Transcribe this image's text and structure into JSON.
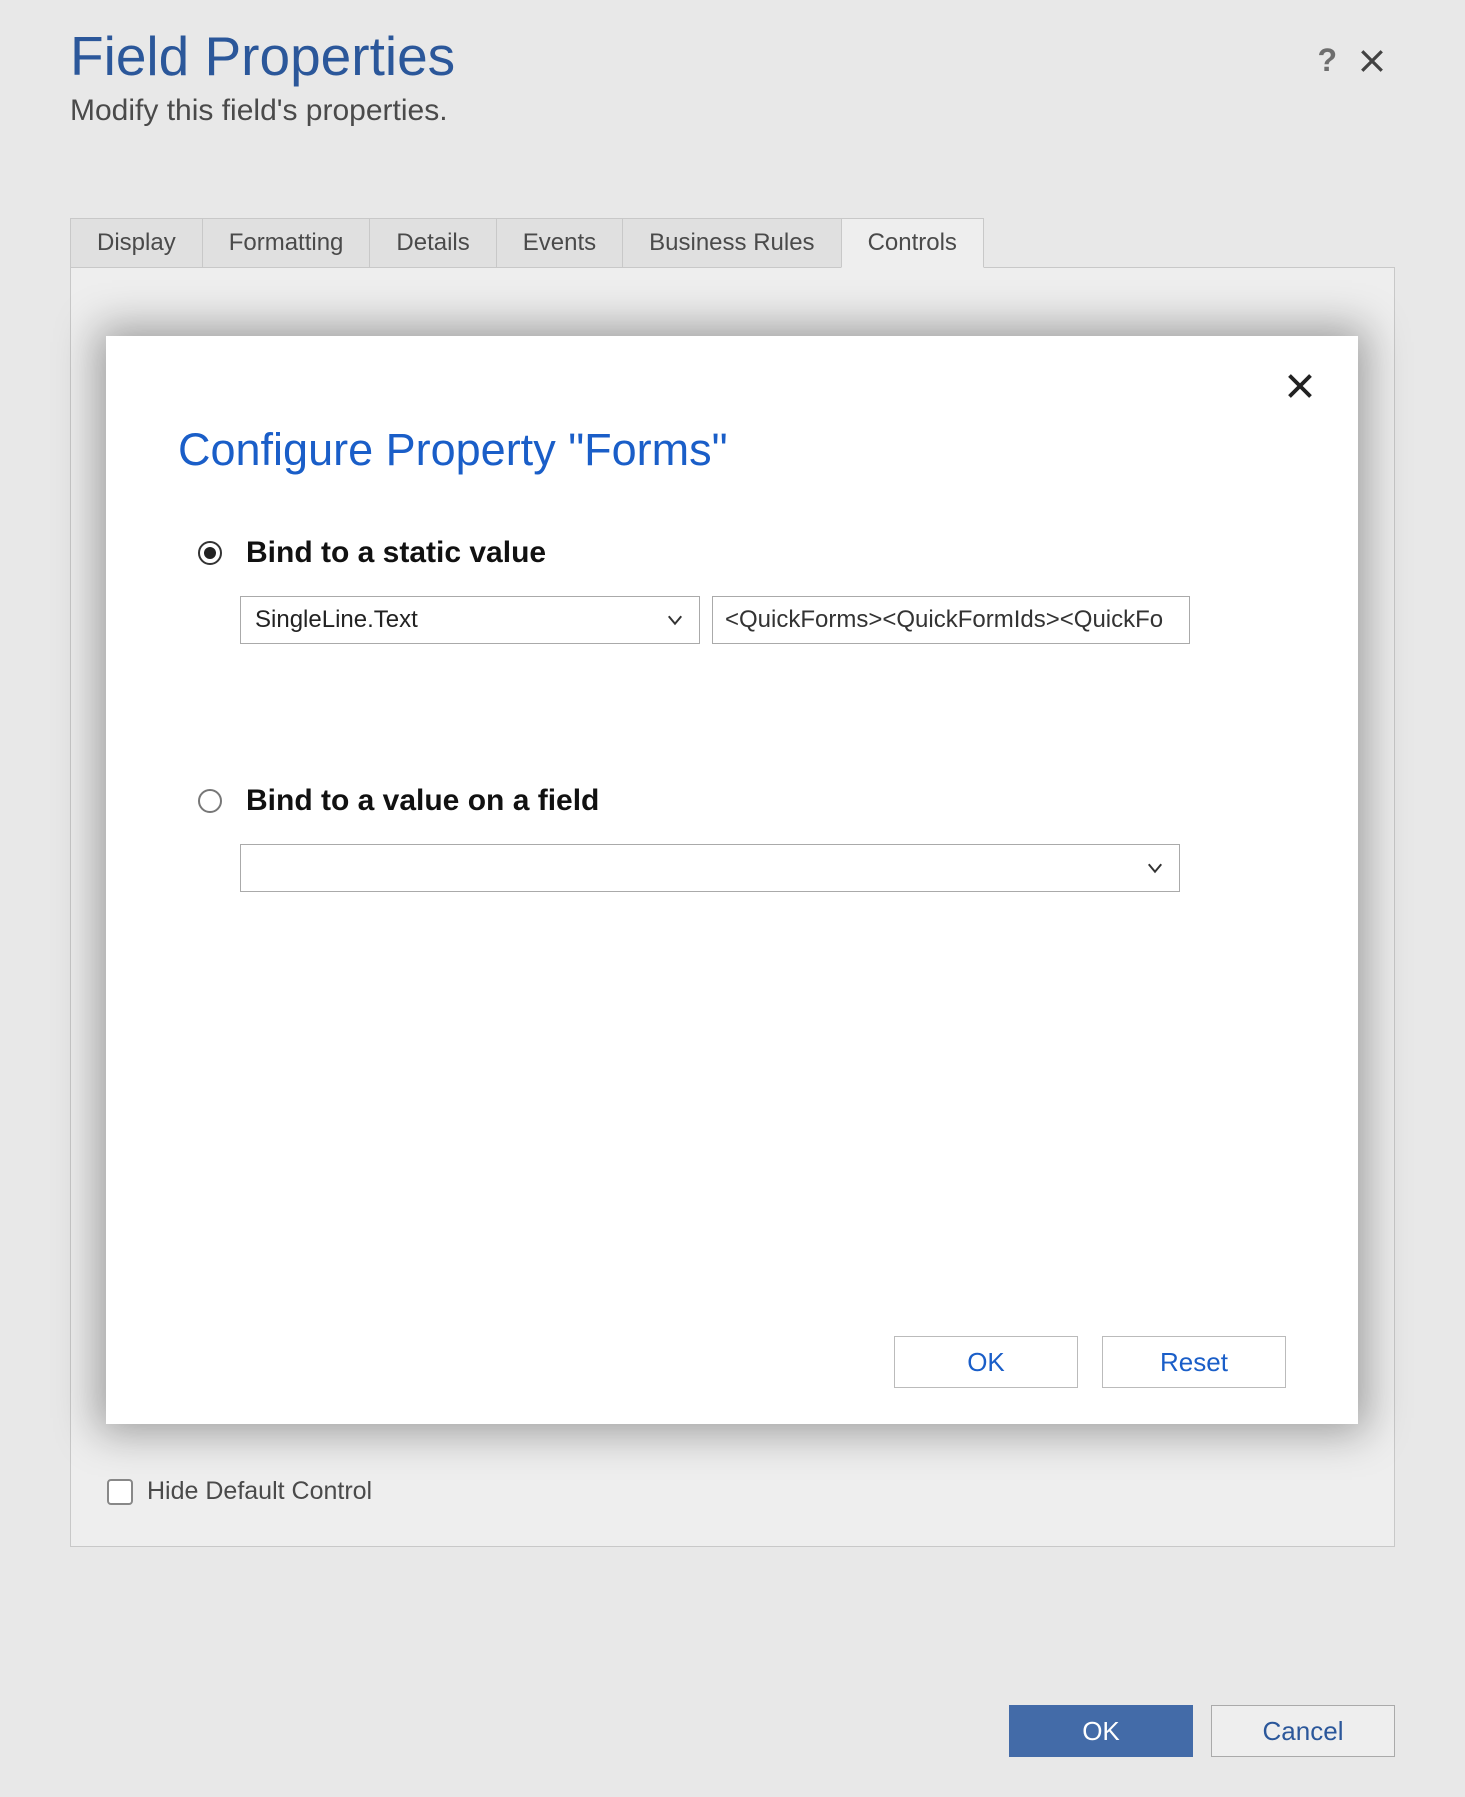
{
  "page": {
    "title": "Field Properties",
    "subtitle": "Modify this field's properties."
  },
  "header_icons": {
    "help": "?",
    "close": "close-icon"
  },
  "tabs": {
    "items": [
      {
        "label": "Display"
      },
      {
        "label": "Formatting"
      },
      {
        "label": "Details"
      },
      {
        "label": "Events"
      },
      {
        "label": "Business Rules"
      },
      {
        "label": "Controls"
      }
    ],
    "active_index": 5
  },
  "tab_content": {
    "hide_default_control_label": "Hide Default Control",
    "hide_default_control_checked": false
  },
  "page_footer": {
    "ok_label": "OK",
    "cancel_label": "Cancel"
  },
  "modal": {
    "title": "Configure Property \"Forms\"",
    "close_icon": "close-icon",
    "options": {
      "static": {
        "selected": true,
        "label": "Bind to a static value",
        "type_select_value": "SingleLine.Text",
        "text_value": "<QuickForms><QuickFormIds><QuickFo"
      },
      "field": {
        "selected": false,
        "label": "Bind to a value on a field",
        "field_select_value": ""
      }
    },
    "footer": {
      "ok_label": "OK",
      "reset_label": "Reset"
    }
  }
}
